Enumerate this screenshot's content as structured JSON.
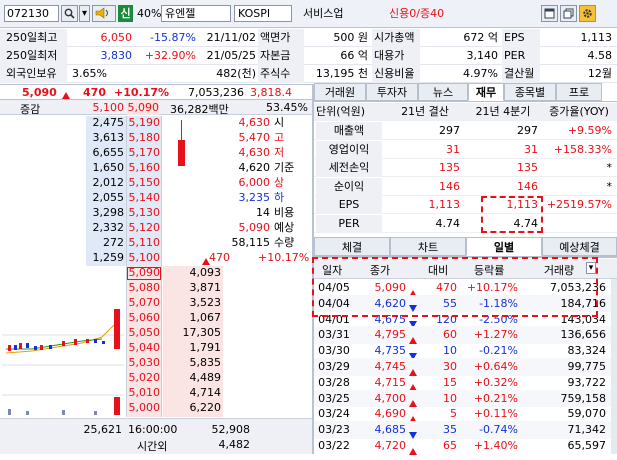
{
  "toolbar": {
    "code": "072130",
    "badge": "신",
    "margin": "40%",
    "name": "유엔젤",
    "market": "KOSPI",
    "sector": "서비스업",
    "credit": "신용0/증40"
  },
  "summary": {
    "row1": {
      "l1": "250일최고",
      "v1": "6,050",
      "p1": "-15.87%",
      "d1": "21/11/02",
      "l2": "액면가",
      "v2": "500 원",
      "l3": "시가총액",
      "v3": "672 억",
      "l4": "EPS",
      "v4": "1,113"
    },
    "row2": {
      "l1": "250일최저",
      "v1": "3,830",
      "p1": "+32.90%",
      "d1": "21/05/25",
      "l2": "자본금",
      "v2": "66 억",
      "l3": "대용가",
      "v3": "3,140",
      "l4": "PER",
      "v4": "4.58"
    },
    "row3": {
      "l1": "외국인보유",
      "v1": "3.65%",
      "v1b": "482(천)",
      "l2": "주식수",
      "v2": "13,195 천",
      "l3": "신용비율",
      "v3": "4.97%",
      "l4": "결산월",
      "v4": "12월"
    }
  },
  "quote": {
    "price": "5,090",
    "change": "470",
    "rate": "+10.17%",
    "volume": "7,053,236",
    "vol_ratio": "3,818.4"
  },
  "orderbook": {
    "header": {
      "label": "증감",
      "ask": "5,100",
      "bid": "5,090",
      "amount": "36,282백만",
      "pct": "53.45%"
    },
    "asks": [
      {
        "qty": "2,475",
        "price": "5,190"
      },
      {
        "qty": "3,613",
        "price": "5,180"
      },
      {
        "qty": "6,655",
        "price": "5,170"
      },
      {
        "qty": "1,650",
        "price": "5,160"
      },
      {
        "qty": "2,012",
        "price": "5,150"
      },
      {
        "qty": "2,055",
        "price": "5,140"
      },
      {
        "qty": "3,298",
        "price": "5,130"
      },
      {
        "qty": "2,332",
        "price": "5,120"
      },
      {
        "qty": "272",
        "price": "5,110"
      },
      {
        "qty": "1,259",
        "price": "5,100"
      }
    ],
    "info": [
      {
        "v": "4,630",
        "k": "시"
      },
      {
        "v": "5,470",
        "k": "고"
      },
      {
        "v": "4,630",
        "k": "저"
      },
      {
        "v": "4,620",
        "k": "기준"
      },
      {
        "v": "6,000",
        "k": "상"
      },
      {
        "v": "3,235",
        "k": "하"
      },
      {
        "v": "14",
        "k": "비용"
      },
      {
        "v": "5,090",
        "k": "예상"
      },
      {
        "v": "58,115",
        "k": "수량"
      },
      {
        "v": "470",
        "k": "+10.17%"
      }
    ],
    "bids": [
      {
        "price": "5,090",
        "qty": "4,093"
      },
      {
        "price": "5,080",
        "qty": "3,871"
      },
      {
        "price": "5,070",
        "qty": "3,523"
      },
      {
        "price": "5,060",
        "qty": "1,067"
      },
      {
        "price": "5,050",
        "qty": "17,305"
      },
      {
        "price": "5,040",
        "qty": "1,791"
      },
      {
        "price": "5,030",
        "qty": "5,835"
      },
      {
        "price": "5,020",
        "qty": "4,489"
      },
      {
        "price": "5,010",
        "qty": "4,714"
      },
      {
        "price": "5,000",
        "qty": "6,220"
      }
    ],
    "footer": {
      "total_ask": "25,621",
      "time": "16:00:00",
      "total_bid": "52,908",
      "after_label": "시간외",
      "after_qty": "4,482"
    }
  },
  "fin_tabs": [
    "거래원",
    "투자자",
    "뉴스",
    "재무",
    "종목별",
    "프로"
  ],
  "financials": {
    "headers": [
      "단위(억원)",
      "21년 결산",
      "21년 4분기",
      "증가율(YOY)"
    ],
    "rows": [
      {
        "name": "매출액",
        "a": "297",
        "b": "297",
        "c": "+9.59%"
      },
      {
        "name": "영업이익",
        "a": "31",
        "b": "31",
        "c": "+158.33%"
      },
      {
        "name": "세전손익",
        "a": "135",
        "b": "135",
        "c": "*"
      },
      {
        "name": "순이익",
        "a": "146",
        "b": "146",
        "c": "*"
      },
      {
        "name": "EPS",
        "a": "1,113",
        "b": "1,113",
        "c": "+2519.57%"
      },
      {
        "name": "PER",
        "a": "4.74",
        "b": "4.74",
        "c": ""
      }
    ]
  },
  "daily_tabs": [
    "체결",
    "차트",
    "일별",
    "예상체결"
  ],
  "daily": {
    "headers": [
      "일자",
      "종가",
      "대비",
      "등락률",
      "거래량"
    ],
    "rows": [
      {
        "date": "04/05",
        "close": "5,090",
        "dir": "up",
        "chg": "470",
        "rate": "+10.17%",
        "vol": "7,053,236"
      },
      {
        "date": "04/04",
        "close": "4,620",
        "dir": "dn",
        "chg": "55",
        "rate": "-1.18%",
        "vol": "184,716"
      },
      {
        "date": "04/01",
        "close": "4,675",
        "dir": "dn",
        "chg": "120",
        "rate": "-2.50%",
        "vol": "143,034"
      },
      {
        "date": "03/31",
        "close": "4,795",
        "dir": "up",
        "chg": "60",
        "rate": "+1.27%",
        "vol": "136,656"
      },
      {
        "date": "03/30",
        "close": "4,735",
        "dir": "dn",
        "chg": "10",
        "rate": "-0.21%",
        "vol": "83,324"
      },
      {
        "date": "03/29",
        "close": "4,745",
        "dir": "up",
        "chg": "30",
        "rate": "+0.64%",
        "vol": "99,775"
      },
      {
        "date": "03/28",
        "close": "4,715",
        "dir": "up",
        "chg": "15",
        "rate": "+0.32%",
        "vol": "93,722"
      },
      {
        "date": "03/25",
        "close": "4,700",
        "dir": "up",
        "chg": "10",
        "rate": "+0.21%",
        "vol": "759,158"
      },
      {
        "date": "03/24",
        "close": "4,690",
        "dir": "up",
        "chg": "5",
        "rate": "+0.11%",
        "vol": "59,070"
      },
      {
        "date": "03/23",
        "close": "4,685",
        "dir": "dn",
        "chg": "35",
        "rate": "-0.74%",
        "vol": "71,342"
      },
      {
        "date": "03/22",
        "close": "4,720",
        "dir": "up",
        "chg": "65",
        "rate": "+1.40%",
        "vol": "65,597"
      }
    ]
  },
  "colors": {
    "up": "#e8101a",
    "down": "#1530d8",
    "ask_bg": "#dfe9f8",
    "bid_bg": "#fbe4e4",
    "header_bg": "#eef0f5"
  }
}
